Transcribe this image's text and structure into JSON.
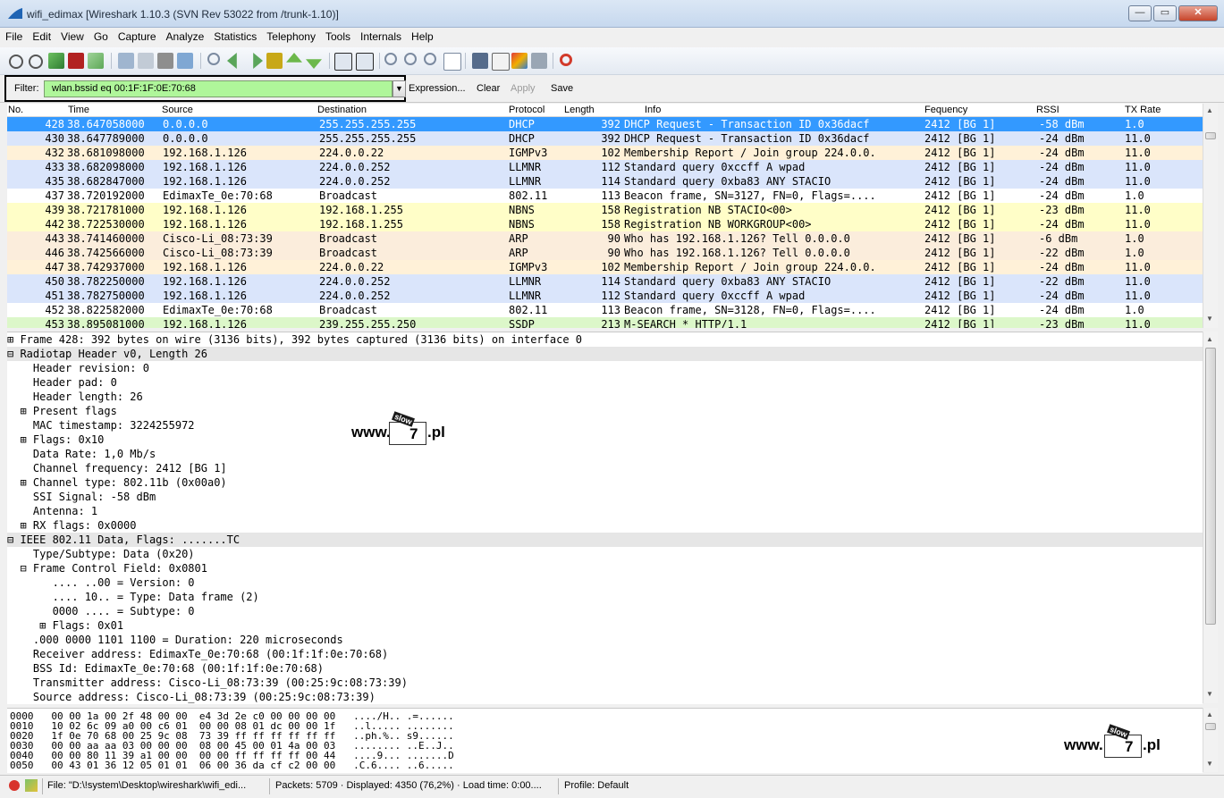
{
  "window": {
    "title": "wifi_edimax  [Wireshark 1.10.3  (SVN Rev 53022 from /trunk-1.10)]",
    "minimize": "—",
    "maximize": "▭",
    "close": "✕"
  },
  "menu": [
    "File",
    "Edit",
    "View",
    "Go",
    "Capture",
    "Analyze",
    "Statistics",
    "Telephony",
    "Tools",
    "Internals",
    "Help"
  ],
  "filter": {
    "label": "Filter:",
    "value": "wlan.bssid eq 00:1F:1F:0E:70:68",
    "expression": "Expression...",
    "clear": "Clear",
    "apply": "Apply",
    "save": "Save"
  },
  "columns": [
    "No.",
    "Time",
    "Source",
    "Destination",
    "Protocol",
    "Length",
    "Info",
    "Fequency",
    "RSSI",
    "TX Rate"
  ],
  "packets": [
    {
      "no": "428",
      "time": "38.647058000",
      "src": "0.0.0.0",
      "dst": "255.255.255.255",
      "proto": "DHCP",
      "len": "392",
      "info": "DHCP Request  - Transaction ID 0x36dacf",
      "freq": "2412 [BG 1]",
      "rssi": "-58 dBm",
      "rate": "1.0",
      "cls": "sel"
    },
    {
      "no": "430",
      "time": "38.647789000",
      "src": "0.0.0.0",
      "dst": "255.255.255.255",
      "proto": "DHCP",
      "len": "392",
      "info": "DHCP Request  - Transaction ID 0x36dacf",
      "freq": "2412 [BG 1]",
      "rssi": "-24 dBm",
      "rate": "11.0",
      "cls": "udp"
    },
    {
      "no": "432",
      "time": "38.681098000",
      "src": "192.168.1.126",
      "dst": "224.0.0.22",
      "proto": "IGMPv3",
      "len": "102",
      "info": "Membership Report / Join group 224.0.0.",
      "freq": "2412 [BG 1]",
      "rssi": "-24 dBm",
      "rate": "11.0",
      "cls": "igmp"
    },
    {
      "no": "433",
      "time": "38.682098000",
      "src": "192.168.1.126",
      "dst": "224.0.0.252",
      "proto": "LLMNR",
      "len": "112",
      "info": "Standard query 0xccff  A wpad",
      "freq": "2412 [BG 1]",
      "rssi": "-24 dBm",
      "rate": "11.0",
      "cls": "llmnr"
    },
    {
      "no": "435",
      "time": "38.682847000",
      "src": "192.168.1.126",
      "dst": "224.0.0.252",
      "proto": "LLMNR",
      "len": "114",
      "info": "Standard query 0xba83  ANY STACIO",
      "freq": "2412 [BG 1]",
      "rssi": "-24 dBm",
      "rate": "11.0",
      "cls": "llmnr"
    },
    {
      "no": "437",
      "time": "38.720192000",
      "src": "EdimaxTe_0e:70:68",
      "dst": "Broadcast",
      "proto": "802.11",
      "len": "113",
      "info": "Beacon frame, SN=3127, FN=0, Flags=....",
      "freq": "2412 [BG 1]",
      "rssi": "-24 dBm",
      "rate": "1.0",
      "cls": "beacon"
    },
    {
      "no": "439",
      "time": "38.721781000",
      "src": "192.168.1.126",
      "dst": "192.168.1.255",
      "proto": "NBNS",
      "len": "158",
      "info": "Registration NB STACIO<00>",
      "freq": "2412 [BG 1]",
      "rssi": "-23 dBm",
      "rate": "11.0",
      "cls": "nbns"
    },
    {
      "no": "442",
      "time": "38.722530000",
      "src": "192.168.1.126",
      "dst": "192.168.1.255",
      "proto": "NBNS",
      "len": "158",
      "info": "Registration NB WORKGROUP<00>",
      "freq": "2412 [BG 1]",
      "rssi": "-24 dBm",
      "rate": "11.0",
      "cls": "nbns"
    },
    {
      "no": "443",
      "time": "38.741460000",
      "src": "Cisco-Li_08:73:39",
      "dst": "Broadcast",
      "proto": "ARP",
      "len": "90",
      "info": "Who has 192.168.1.126?  Tell 0.0.0.0",
      "freq": "2412 [BG 1]",
      "rssi": "-6 dBm",
      "rate": "1.0",
      "cls": "arp"
    },
    {
      "no": "446",
      "time": "38.742566000",
      "src": "Cisco-Li_08:73:39",
      "dst": "Broadcast",
      "proto": "ARP",
      "len": "90",
      "info": "Who has 192.168.1.126?  Tell 0.0.0.0",
      "freq": "2412 [BG 1]",
      "rssi": "-22 dBm",
      "rate": "1.0",
      "cls": "arp"
    },
    {
      "no": "447",
      "time": "38.742937000",
      "src": "192.168.1.126",
      "dst": "224.0.0.22",
      "proto": "IGMPv3",
      "len": "102",
      "info": "Membership Report / Join group 224.0.0.",
      "freq": "2412 [BG 1]",
      "rssi": "-24 dBm",
      "rate": "11.0",
      "cls": "igmp"
    },
    {
      "no": "450",
      "time": "38.782250000",
      "src": "192.168.1.126",
      "dst": "224.0.0.252",
      "proto": "LLMNR",
      "len": "114",
      "info": "Standard query 0xba83  ANY STACIO",
      "freq": "2412 [BG 1]",
      "rssi": "-22 dBm",
      "rate": "11.0",
      "cls": "llmnr"
    },
    {
      "no": "451",
      "time": "38.782750000",
      "src": "192.168.1.126",
      "dst": "224.0.0.252",
      "proto": "LLMNR",
      "len": "112",
      "info": "Standard query 0xccff  A wpad",
      "freq": "2412 [BG 1]",
      "rssi": "-24 dBm",
      "rate": "11.0",
      "cls": "llmnr"
    },
    {
      "no": "452",
      "time": "38.822582000",
      "src": "EdimaxTe_0e:70:68",
      "dst": "Broadcast",
      "proto": "802.11",
      "len": "113",
      "info": "Beacon frame, SN=3128, FN=0, Flags=....",
      "freq": "2412 [BG 1]",
      "rssi": "-24 dBm",
      "rate": "1.0",
      "cls": "beacon"
    },
    {
      "no": "453",
      "time": "38.895081000",
      "src": "192.168.1.126",
      "dst": "239.255.255.250",
      "proto": "SSDP",
      "len": "213",
      "info": "M-SEARCH * HTTP/1.1",
      "freq": "2412 [BG 1]",
      "rssi": "-23 dBm",
      "rate": "11.0",
      "cls": "ssdp"
    }
  ],
  "details": [
    {
      "text": "⊞ Frame 428: 392 bytes on wire (3136 bits), 392 bytes captured (3136 bits) on interface 0",
      "hl": false
    },
    {
      "text": "⊟ Radiotap Header v0, Length 26",
      "hl": true
    },
    {
      "text": "    Header revision: 0",
      "hl": false
    },
    {
      "text": "    Header pad: 0",
      "hl": false
    },
    {
      "text": "    Header length: 26",
      "hl": false
    },
    {
      "text": "  ⊞ Present flags",
      "hl": false
    },
    {
      "text": "    MAC timestamp: 3224255972",
      "hl": false
    },
    {
      "text": "  ⊞ Flags: 0x10",
      "hl": false
    },
    {
      "text": "    Data Rate: 1,0 Mb/s",
      "hl": false
    },
    {
      "text": "    Channel frequency: 2412 [BG 1]",
      "hl": false
    },
    {
      "text": "  ⊞ Channel type: 802.11b (0x00a0)",
      "hl": false
    },
    {
      "text": "    SSI Signal: -58 dBm",
      "hl": false
    },
    {
      "text": "    Antenna: 1",
      "hl": false
    },
    {
      "text": "  ⊞ RX flags: 0x0000",
      "hl": false
    },
    {
      "text": "⊟ IEEE 802.11 Data, Flags: .......TC",
      "hl": true
    },
    {
      "text": "    Type/Subtype: Data (0x20)",
      "hl": false
    },
    {
      "text": "  ⊟ Frame Control Field: 0x0801",
      "hl": false
    },
    {
      "text": "       .... ..00 = Version: 0",
      "hl": false
    },
    {
      "text": "       .... 10.. = Type: Data frame (2)",
      "hl": false
    },
    {
      "text": "       0000 .... = Subtype: 0",
      "hl": false
    },
    {
      "text": "     ⊞ Flags: 0x01",
      "hl": false
    },
    {
      "text": "    .000 0000 1101 1100 = Duration: 220 microseconds",
      "hl": false
    },
    {
      "text": "    Receiver address: EdimaxTe_0e:70:68 (00:1f:1f:0e:70:68)",
      "hl": false
    },
    {
      "text": "    BSS Id: EdimaxTe_0e:70:68 (00:1f:1f:0e:70:68)",
      "hl": false
    },
    {
      "text": "    Transmitter address: Cisco-Li_08:73:39 (00:25:9c:08:73:39)",
      "hl": false
    },
    {
      "text": "    Source address: Cisco-Li_08:73:39 (00:25:9c:08:73:39)",
      "hl": false
    }
  ],
  "hexdump": [
    "0000   00 00 1a 00 2f 48 00 00  e4 3d 2e c0 00 00 00 00   ..../H.. .=......",
    "0010   10 02 6c 09 a0 00 c6 01  00 00 08 01 dc 00 00 1f   ..l..... ........",
    "0020   1f 0e 70 68 00 25 9c 08  73 39 ff ff ff ff ff ff   ..ph.%.. s9......",
    "0030   00 00 aa aa 03 00 00 00  08 00 45 00 01 4a 00 03   ........ ..E..J..",
    "0040   00 00 80 11 39 a1 00 00  00 00 ff ff ff ff 00 44   ....9... .......D",
    "0050   00 43 01 36 12 05 01 01  06 00 36 da cf c2 00 00   .C.6.... ..6....."
  ],
  "watermark": {
    "prefix": "www.",
    "ribbon": "slow",
    "digit": "7",
    "suffix": ".pl"
  },
  "status": {
    "file": "File: \"D:\\!system\\Desktop\\wireshark\\wifi_edi...",
    "packets": "Packets: 5709 · Displayed: 4350 (76,2%)  · Load time: 0:00....",
    "profile": "Profile: Default"
  },
  "colors": {
    "selected": "#3399ff",
    "filter_ok": "#aff69a"
  }
}
